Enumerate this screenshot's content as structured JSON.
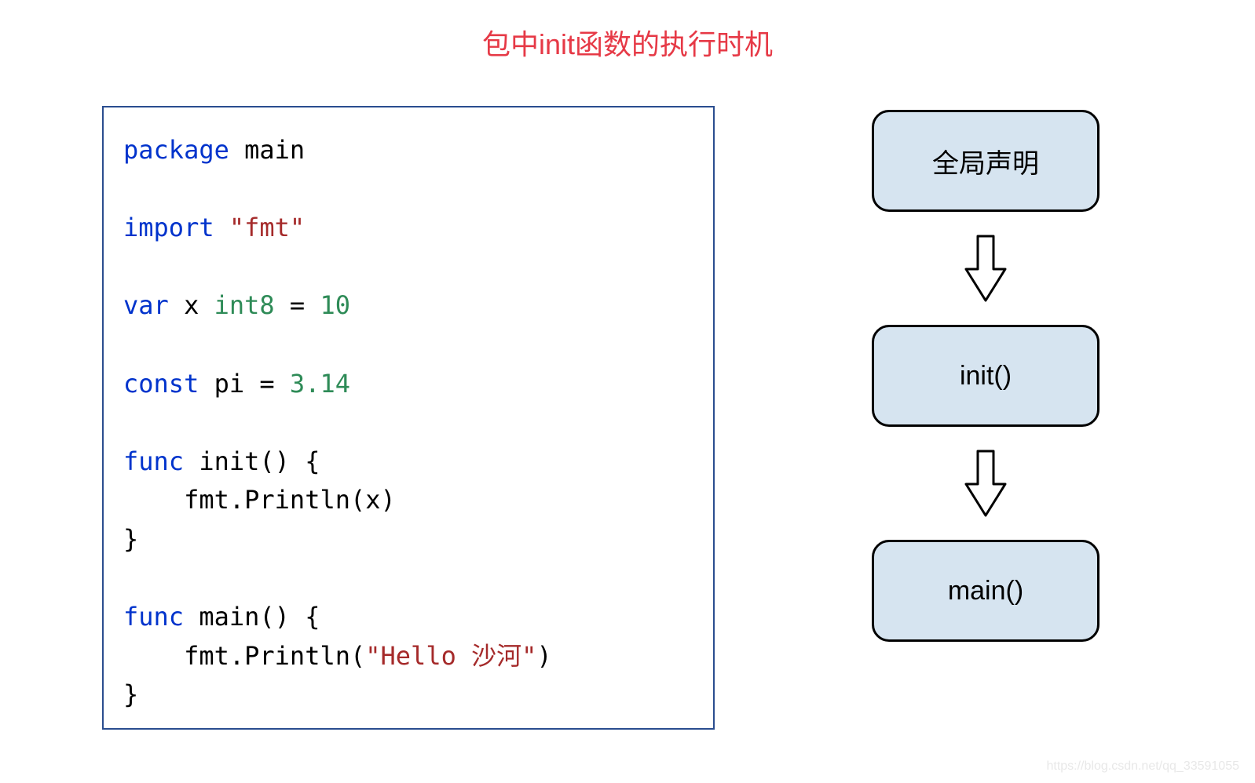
{
  "title": "包中init函数的执行时机",
  "code": {
    "line1_kw": "package",
    "line1_ident": " main",
    "line2_kw": "import",
    "line2_str": " \"fmt\"",
    "line3_kw": "var",
    "line3_ident": " x ",
    "line3_type": "int8",
    "line3_eq": " = ",
    "line3_num": "10",
    "line4_kw": "const",
    "line4_ident": " pi = ",
    "line4_num": "3.14",
    "line5_kw": "func",
    "line5_ident": " init() {",
    "line6_ident": "    fmt.Println(x)",
    "line7_ident": "}",
    "line8_kw": "func",
    "line8_ident": " main() {",
    "line9_ident_a": "    fmt.Println(",
    "line9_str": "\"Hello 沙河\"",
    "line9_ident_b": ")",
    "line10_ident": "}"
  },
  "flow": {
    "box1": "全局声明",
    "box2": "init()",
    "box3": "main()"
  },
  "watermark": "https://blog.csdn.net/qq_33591055"
}
